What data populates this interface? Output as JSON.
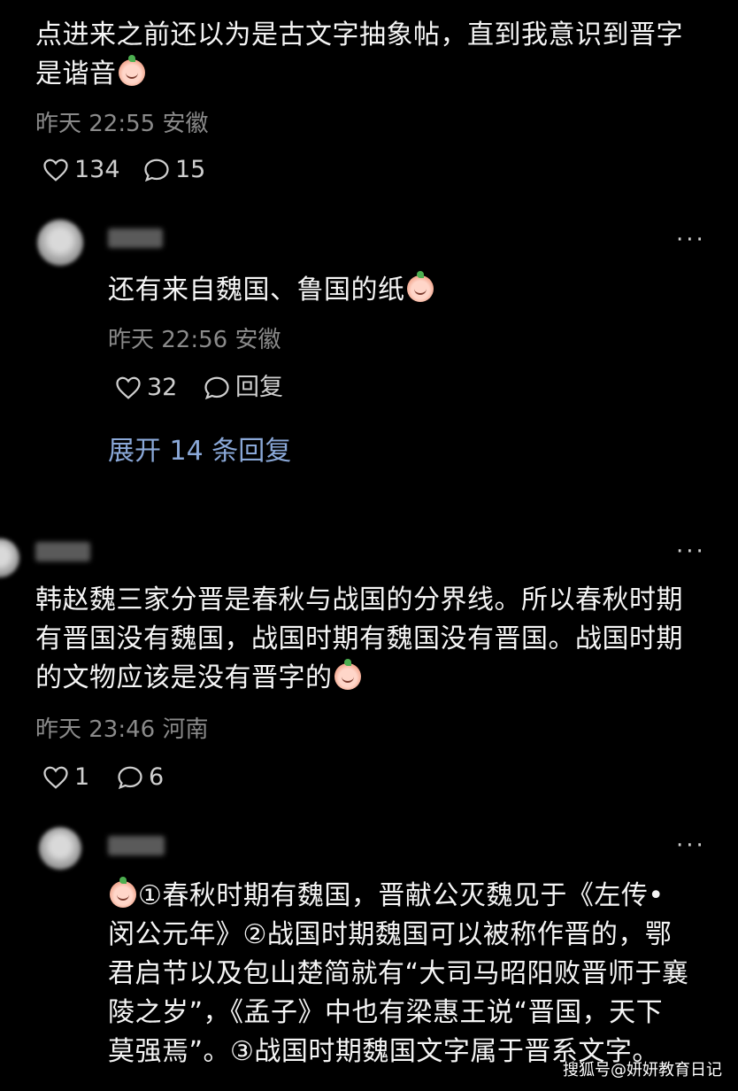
{
  "comment1": {
    "text_line1": "点进来之前还以为是古文字抽象帖，直到我意识到晋字",
    "text_line2": "是谐音",
    "meta": "昨天 22:55 安徽",
    "likes": "134",
    "replies": "15"
  },
  "reply1": {
    "text": "还有来自魏国、鲁国的纸",
    "meta": "昨天 22:56 安徽",
    "likes": "32",
    "reply_label": "回复",
    "more": "···"
  },
  "expand_replies": "展开 14 条回复",
  "comment2": {
    "text_line1": "韩赵魏三家分晋是春秋与战国的分界线。所以春秋时期",
    "text_line2": "有晋国没有魏国，战国时期有魏国没有晋国。战国时期",
    "text_line3": "的文物应该是没有晋字的",
    "meta": "昨天 23:46 河南",
    "likes": "1",
    "replies": "6",
    "more": "···"
  },
  "reply2": {
    "text_line1": "①春秋时期有魏国，晋献公灭魏见于《左传•",
    "text_line2": "闵公元年》②战国时期魏国可以被称作晋的，鄂",
    "text_line3": "君启节以及包山楚简就有“大司马昭阳败晋师于襄",
    "text_line4": "陵之岁”，《孟子》中也有梁惠王说“晋国，天下",
    "text_line5": "莫强焉”。③战国时期魏国文字属于晋系文字。",
    "more": "···"
  },
  "watermark": "搜狐号@妍妍教育日记",
  "colors": {
    "background": "#000000",
    "link": "#8aa8d8",
    "meta": "#8a8a8a"
  }
}
